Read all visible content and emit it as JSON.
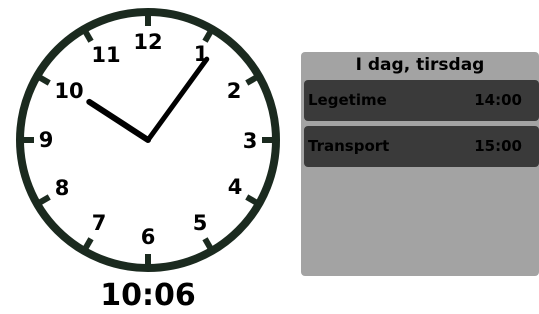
{
  "clock": {
    "numbers": [
      "12",
      "1",
      "2",
      "3",
      "4",
      "5",
      "6",
      "7",
      "8",
      "9",
      "10",
      "11"
    ],
    "hour": 10,
    "minute": 6,
    "digital_time": "10:06",
    "colors": {
      "rim": "#1b2a1f",
      "hands": "#000000",
      "face": "#ffffff"
    }
  },
  "agenda": {
    "title": "I dag, tirsdag",
    "events": [
      {
        "name": "Legetime",
        "time": "14:00"
      },
      {
        "name": "Transport",
        "time": "15:00"
      }
    ],
    "colors": {
      "panel": "#a3a3a3",
      "row": "#3a3a3a"
    }
  }
}
